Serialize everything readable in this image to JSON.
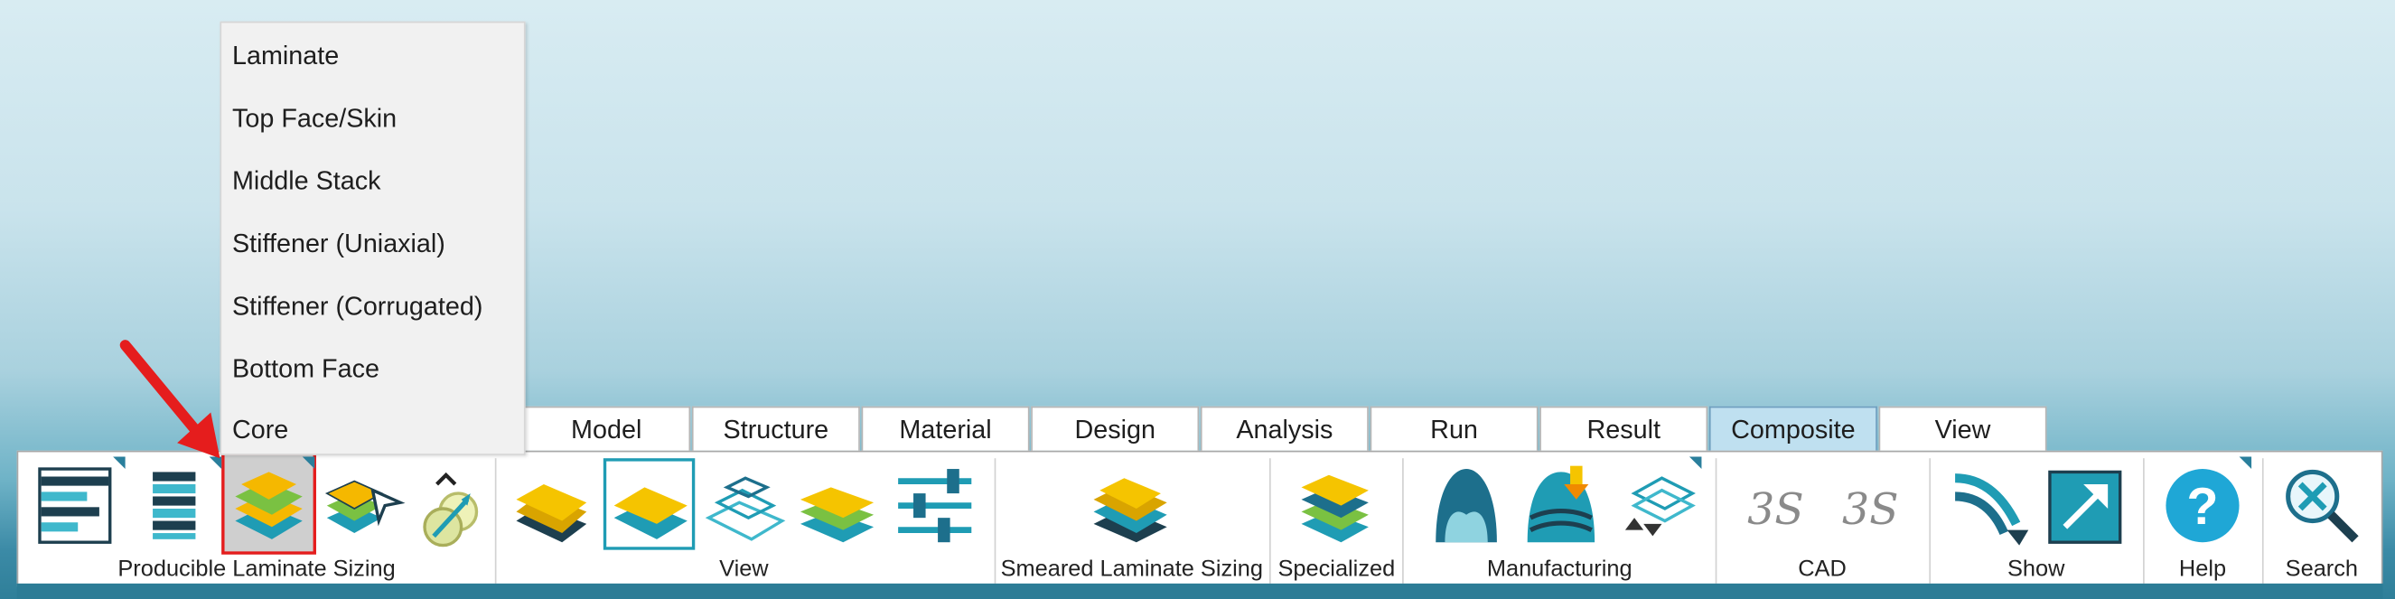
{
  "menu": {
    "items": [
      {
        "label": "Laminate"
      },
      {
        "label": "Top Face/Skin"
      },
      {
        "label": "Middle Stack"
      },
      {
        "label": "Stiffener (Uniaxial)"
      },
      {
        "label": "Stiffener (Corrugated)"
      },
      {
        "label": "Bottom Face"
      },
      {
        "label": "Core"
      }
    ]
  },
  "tabs": [
    {
      "label": "Model"
    },
    {
      "label": "Structure"
    },
    {
      "label": "Material"
    },
    {
      "label": "Design"
    },
    {
      "label": "Analysis"
    },
    {
      "label": "Run"
    },
    {
      "label": "Result"
    },
    {
      "label": "Composite",
      "active": true
    },
    {
      "label": "View"
    }
  ],
  "groups": {
    "producible": "Producible Laminate Sizing",
    "view": "View",
    "smeared": "Smeared Laminate Sizing",
    "specialized": "Specialized",
    "manufacturing": "Manufacturing",
    "cad": "CAD",
    "show": "Show",
    "help": "Help",
    "search": "Search"
  },
  "colors": {
    "accent": "#1f9cb4",
    "annotation_arrow": "#e51d1d",
    "active_tab": "#bfe0f0"
  }
}
